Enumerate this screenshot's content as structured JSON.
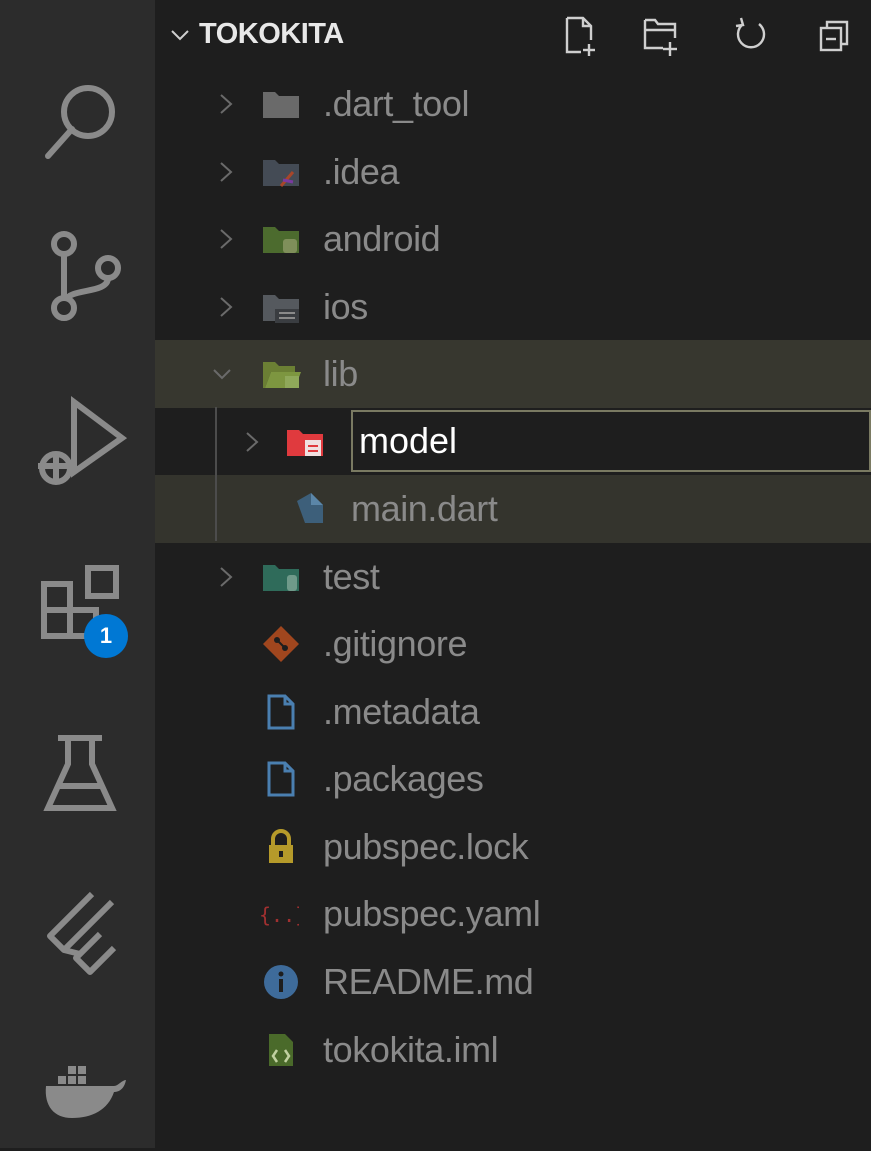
{
  "activity_bar": {
    "items": [
      {
        "name": "search"
      },
      {
        "name": "source-control"
      },
      {
        "name": "run-and-debug"
      },
      {
        "name": "extensions",
        "badge": "1"
      },
      {
        "name": "testing"
      },
      {
        "name": "flutter"
      },
      {
        "name": "docker"
      }
    ]
  },
  "explorer": {
    "title": "TOKOKITA",
    "actions": [
      "new-file-icon",
      "new-folder-icon",
      "refresh-icon",
      "collapse-all-icon"
    ],
    "rename_value": "model",
    "items": [
      {
        "label": ".dart_tool",
        "type": "folder",
        "expanded": false
      },
      {
        "label": ".idea",
        "type": "folder",
        "expanded": false
      },
      {
        "label": "android",
        "type": "folder",
        "expanded": false
      },
      {
        "label": "ios",
        "type": "folder",
        "expanded": false
      },
      {
        "label": "lib",
        "type": "folder",
        "expanded": true
      },
      {
        "label": "main.dart",
        "type": "file"
      },
      {
        "label": "test",
        "type": "folder",
        "expanded": false
      },
      {
        "label": ".gitignore",
        "type": "file"
      },
      {
        "label": ".metadata",
        "type": "file"
      },
      {
        "label": ".packages",
        "type": "file"
      },
      {
        "label": "pubspec.lock",
        "type": "file"
      },
      {
        "label": "pubspec.yaml",
        "type": "file"
      },
      {
        "label": "README.md",
        "type": "file"
      },
      {
        "label": "tokokita.iml",
        "type": "file"
      }
    ]
  },
  "colors": {
    "activity_bg": "#2c2c2c",
    "sidebar_bg": "#1e1e1e",
    "selected_bg": "#37372f",
    "badge": "#0078d4",
    "text_dim": "#8a8a8a"
  }
}
